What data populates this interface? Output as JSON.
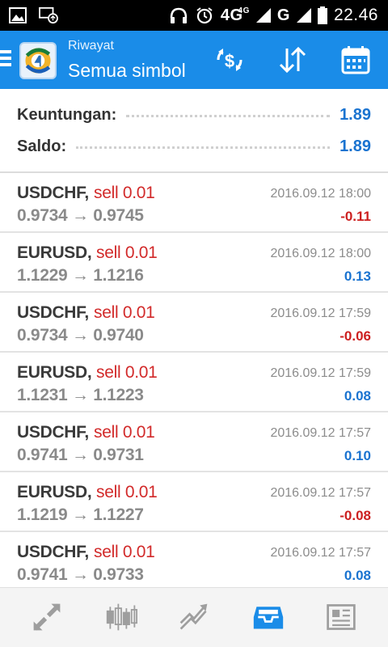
{
  "status_bar": {
    "network1": "4G",
    "network1_small": "4G",
    "network2": "G",
    "time": "22.46"
  },
  "app_bar": {
    "subtitle": "Riwayat",
    "title": "Semua simbol",
    "icons": [
      "menu-icon",
      "app-logo",
      "currency-sort-icon",
      "sort-updown-icon",
      "calendar-icon"
    ]
  },
  "summary": {
    "profit_label": "Keuntungan:",
    "profit_value": "1.89",
    "balance_label": "Saldo:",
    "balance_value": "1.89"
  },
  "trades": [
    {
      "symbol": "USDCHF,",
      "action": "sell 0.01",
      "prices": "0.9734 → 0.9745",
      "date": "2016.09.12 18:00",
      "profit": "-0.11",
      "sign": "neg"
    },
    {
      "symbol": "EURUSD,",
      "action": "sell 0.01",
      "prices": "1.1229 → 1.1216",
      "date": "2016.09.12 18:00",
      "profit": "0.13",
      "sign": "pos"
    },
    {
      "symbol": "USDCHF,",
      "action": "sell 0.01",
      "prices": "0.9734 → 0.9740",
      "date": "2016.09.12 17:59",
      "profit": "-0.06",
      "sign": "neg"
    },
    {
      "symbol": "EURUSD,",
      "action": "sell 0.01",
      "prices": "1.1231 → 1.1223",
      "date": "2016.09.12 17:59",
      "profit": "0.08",
      "sign": "pos"
    },
    {
      "symbol": "USDCHF,",
      "action": "sell 0.01",
      "prices": "0.9741 → 0.9731",
      "date": "2016.09.12 17:57",
      "profit": "0.10",
      "sign": "pos"
    },
    {
      "symbol": "EURUSD,",
      "action": "sell 0.01",
      "prices": "1.1219 → 1.1227",
      "date": "2016.09.12 17:57",
      "profit": "-0.08",
      "sign": "neg"
    },
    {
      "symbol": "USDCHF,",
      "action": "sell 0.01",
      "prices": "0.9741 → 0.9733",
      "date": "2016.09.12 17:57",
      "profit": "0.08",
      "sign": "pos"
    }
  ],
  "bottom_nav": {
    "items": [
      "quotes-icon",
      "chart-icon",
      "trade-icon",
      "history-icon",
      "news-icon"
    ],
    "active": "history-icon"
  },
  "colors": {
    "accent": "#1a8ce8",
    "negative": "#cc2020",
    "positive": "#1a73d0",
    "sell": "#d22a2a"
  }
}
